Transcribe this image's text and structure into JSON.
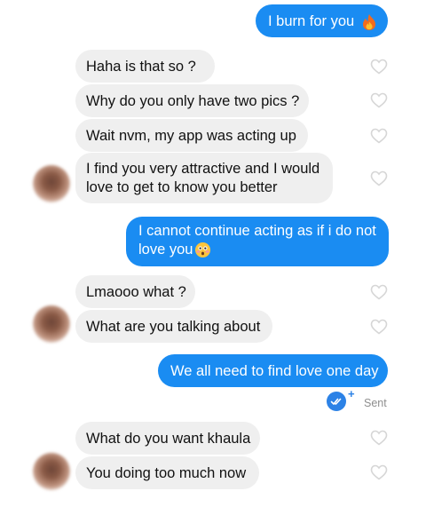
{
  "messages": [
    {
      "from": "me",
      "text": "I burn for you"
    },
    {
      "from": "them",
      "text": "Haha is that so ?"
    },
    {
      "from": "them",
      "text": "Why do you only have two pics ?"
    },
    {
      "from": "them",
      "text": "Wait nvm, my app was acting up"
    },
    {
      "from": "them",
      "line1": "I find you very attractive and I would",
      "line2": "love to get to know you better"
    },
    {
      "from": "me",
      "line1": "I cannot continue acting as if i do not",
      "line2": "love you"
    },
    {
      "from": "them",
      "text": "Lmaooo what ?"
    },
    {
      "from": "them",
      "text": "What are you talking about"
    },
    {
      "from": "me",
      "text": "We all need to find love one day"
    },
    {
      "from": "them",
      "text": "What do you want khaula"
    },
    {
      "from": "them",
      "text": "You doing too much now"
    }
  ],
  "status": {
    "sent_label": "Sent",
    "plus": "+"
  },
  "icons": {
    "fire": "fire-emoji",
    "flushed": "flushed-face-emoji",
    "heart": "heart-outline-icon",
    "check": "double-check-icon"
  },
  "colors": {
    "sent_bubble": "#1a8cf2",
    "received_bubble": "#efefef",
    "status_blue": "#2c82e6"
  }
}
